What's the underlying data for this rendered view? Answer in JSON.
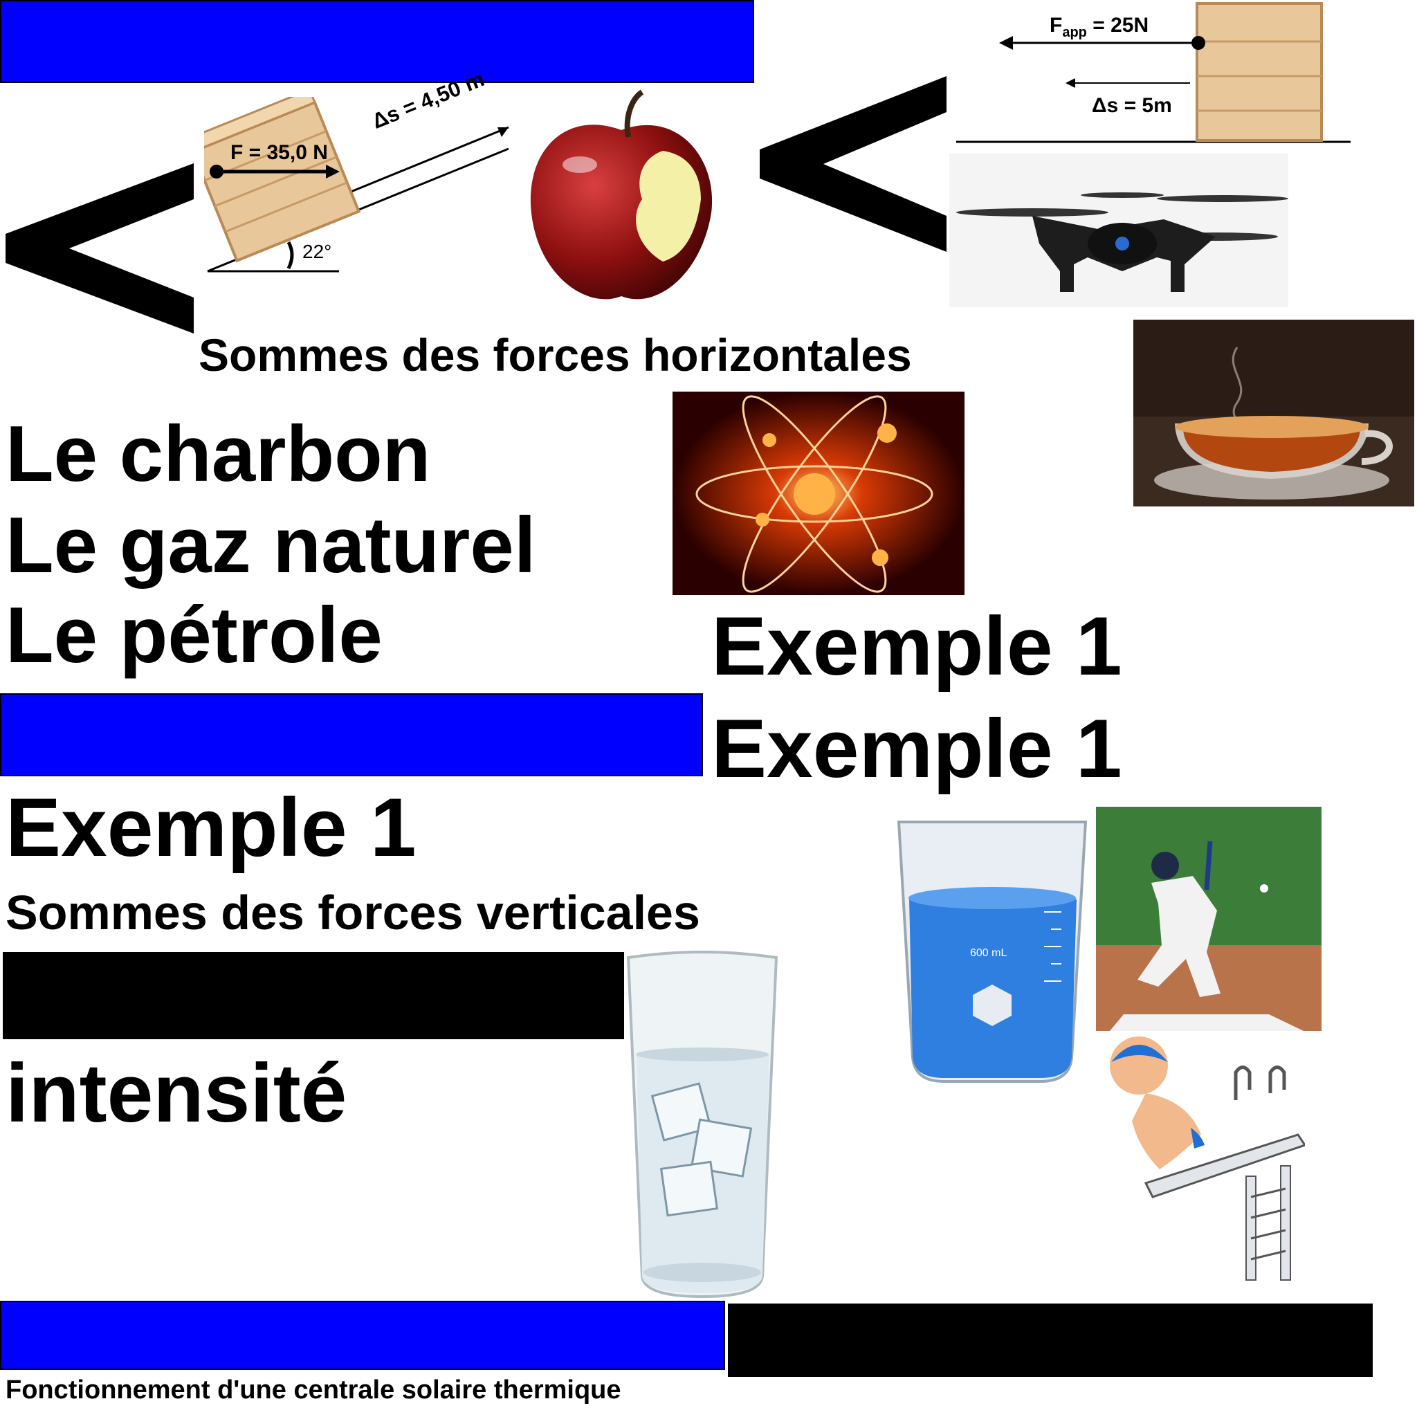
{
  "colors": {
    "blue_bar": "#0000ff",
    "black_bar": "#000000"
  },
  "diagrams": {
    "incline": {
      "force_label": "F = 35,0 N",
      "displacement_label": "Δs = 4,50 m",
      "angle_label": "22°"
    },
    "horizontal": {
      "force_main": "F",
      "force_sub": "app",
      "force_value": " = 25N",
      "displacement_label": "Δs = 5m"
    }
  },
  "symbols": {
    "less_than_left": "<",
    "less_than_right": "<"
  },
  "texts": {
    "horizontal_forces": "Sommes des forces horizontales",
    "coal": "Le charbon",
    "natural_gas": "Le gaz naturel",
    "oil": "Le pétrole",
    "example_a": "Exemple 1",
    "example_b": "Exemple 1",
    "example_c": "Exemple 1",
    "vertical_forces": "Sommes des forces verticales",
    "intensity": "intensité",
    "solar_plant": "Fonctionnement d'une centrale solaire thermique"
  },
  "beaker_label": "600 mL",
  "images": [
    "apple-icon",
    "drone-icon",
    "tea-cup-icon",
    "atom-icon",
    "beaker-icon",
    "baseball-icon",
    "water-glass-icon",
    "diver-icon"
  ]
}
